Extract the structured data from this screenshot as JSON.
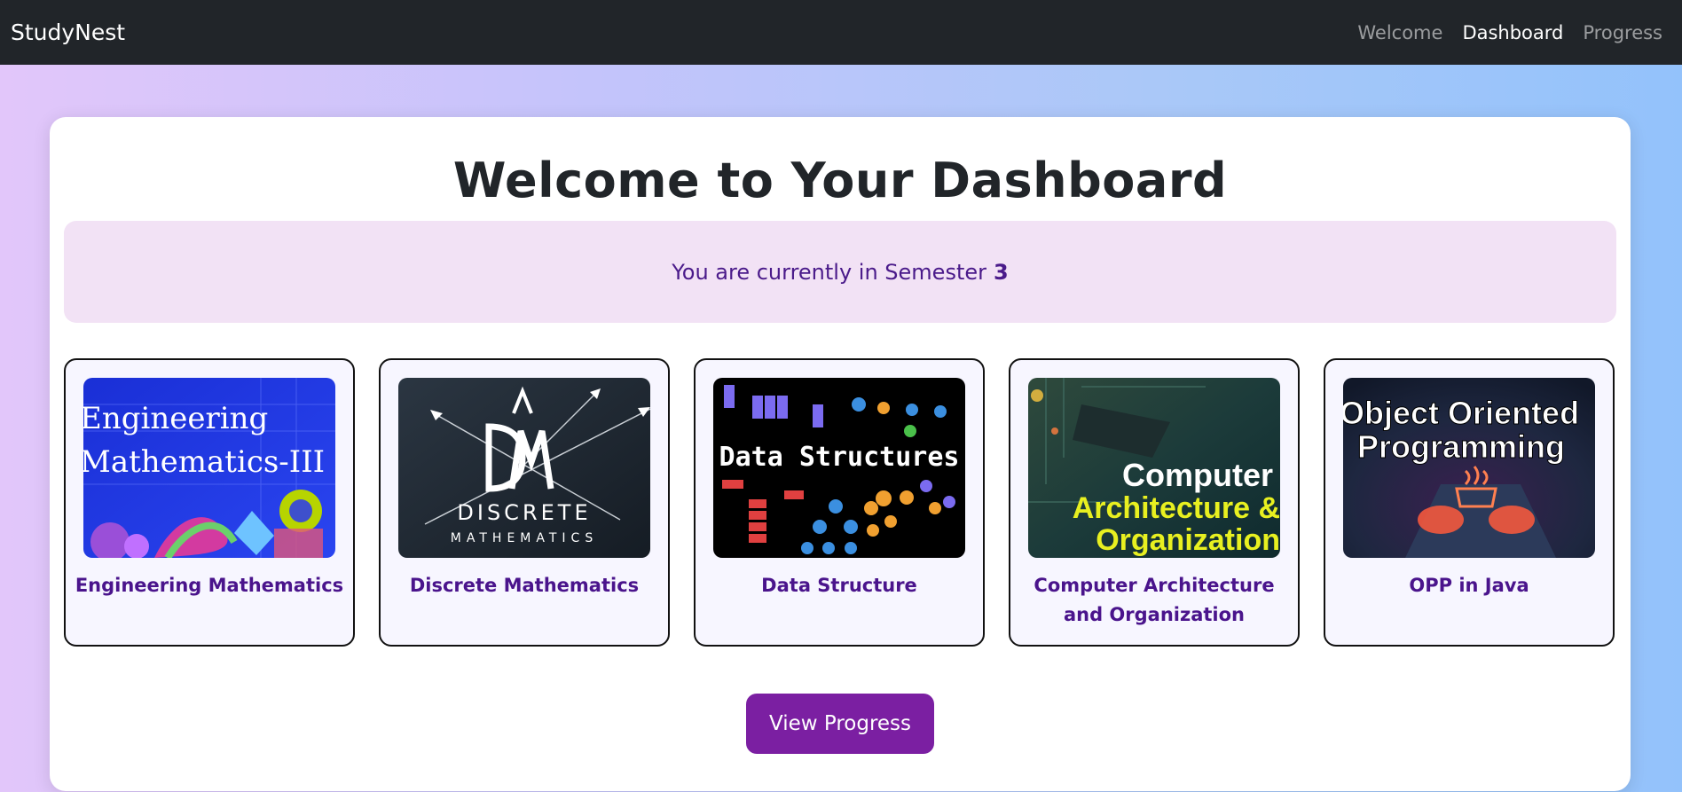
{
  "navbar": {
    "brand": "StudyNest",
    "links": [
      "Welcome",
      "Dashboard",
      "Progress"
    ],
    "active": "Dashboard"
  },
  "dashboard": {
    "title": "Welcome to Your Dashboard",
    "semester_text": "You are currently in Semester",
    "semester_number": "3"
  },
  "courses": [
    {
      "name": "Engineering Mathematics",
      "image_text": [
        "Engineering",
        "Mathematics-III"
      ]
    },
    {
      "name": "Discrete Mathematics",
      "image_text": [
        "DISCRETE",
        "MATHEMATICS"
      ]
    },
    {
      "name": "Data Structure",
      "image_text": [
        "Data Structures"
      ]
    },
    {
      "name": "Computer Architecture and Organization",
      "image_text": [
        "Computer",
        "Architecture &",
        "Organization"
      ]
    },
    {
      "name": "OPP in Java",
      "image_text": [
        "Object Oriented",
        "Programming"
      ]
    }
  ],
  "actions": {
    "view_progress": "View Progress"
  },
  "colors": {
    "navbar_bg": "#212529",
    "accent": "#7b1fa2",
    "course_title": "#4a148c",
    "semester_bg": "#f2e2f5"
  }
}
